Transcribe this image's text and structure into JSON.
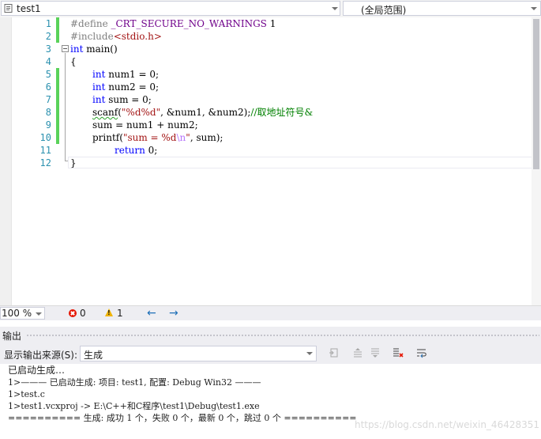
{
  "navbar": {
    "file": "test1",
    "scope": "(全局范围)"
  },
  "editor": {
    "line_numbers": [
      "1",
      "2",
      "3",
      "4",
      "5",
      "6",
      "7",
      "8",
      "9",
      "10",
      "11",
      "12"
    ],
    "code": {
      "l1_pp": "#define ",
      "l1_macro": "_CRT_SECURE_NO_WARNINGS",
      "l1_rest": " 1",
      "l2_pp": "#include",
      "l2_header": "<stdio.h>",
      "l3_kw": "int",
      "l3_rest": " main()",
      "l4": "{",
      "l5_kw": "int",
      "l5_rest": " num1 = 0;",
      "l6_kw": "int",
      "l6_rest": " num2 = 0;",
      "l7_kw": "int",
      "l7_rest": " sum = 0;",
      "l8_fn": "scanf",
      "l8_open": "(",
      "l8_str": "\"%d%d\"",
      "l8_args": ", &num1, &num2);",
      "l8_cmt": "//取地址符号&",
      "l9": "sum = num1 + num2;",
      "l10_fn": "printf(",
      "l10_str_a": "\"sum = %d",
      "l10_esc": "\\n",
      "l10_str_b": "\"",
      "l10_args": ", sum);",
      "l11_kw": "return",
      "l11_rest": " 0;",
      "l12": "}"
    }
  },
  "status": {
    "zoom": "100 %",
    "errors": "0",
    "warnings": "1",
    "back": "←",
    "forward": "→"
  },
  "output_panel": {
    "title": "输出",
    "source_label": "显示输出来源(S):",
    "source_value": "生成",
    "lines": [
      "已启动生成…",
      "1>——— 已启动生成: 项目: test1, 配置: Debug Win32 ———",
      "1>test.c",
      "1>test1.vcxproj -> E:\\C++和C程序\\test1\\Debug\\test1.exe",
      "========== 生成: 成功 1 个，失败 0 个，最新 0 个，跳过 0 个 =========="
    ]
  },
  "watermark": "https://blog.csdn.net/weixin_46428351",
  "colors": {
    "keyword": "#0000ff",
    "string": "#a31515",
    "comment": "#008000",
    "macro": "#6f008a",
    "line_number": "#2b91af",
    "change_bar": "#5ad25a"
  },
  "icons": [
    "file-c-icon",
    "error-icon",
    "warning-icon",
    "nav-back-icon",
    "nav-forward-icon",
    "goto-source-icon",
    "prev-message-icon",
    "next-message-icon",
    "clear-all-icon",
    "word-wrap-icon"
  ]
}
